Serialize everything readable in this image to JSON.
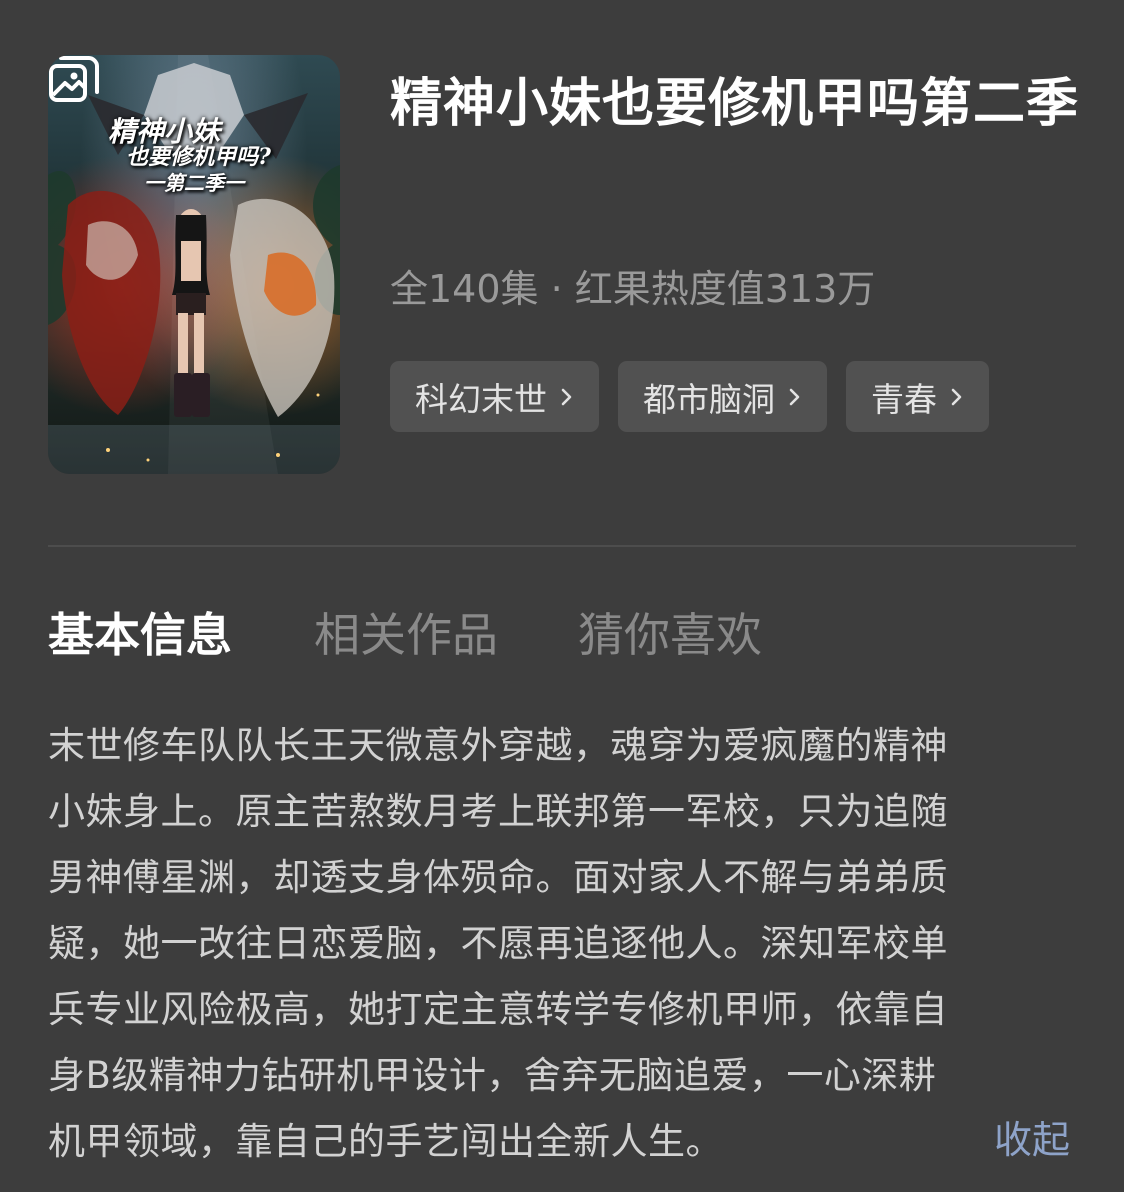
{
  "title": "精神小妹也要修机甲吗第二季",
  "poster": {
    "title_line1": "精神小妹",
    "title_line2": "也要修机甲吗?",
    "title_line3": "一第二季一",
    "icon": "gallery-icon"
  },
  "meta": "全140集 · 红果热度值313万",
  "tags": [
    {
      "label": "科幻末世",
      "icon": "chevron-right-icon"
    },
    {
      "label": "都市脑洞",
      "icon": "chevron-right-icon"
    },
    {
      "label": "青春",
      "icon": "chevron-right-icon"
    }
  ],
  "tabs": [
    {
      "label": "基本信息",
      "active": true
    },
    {
      "label": "相关作品",
      "active": false
    },
    {
      "label": "猜你喜欢",
      "active": false
    }
  ],
  "description_lines": [
    "末世修车队队长王天微意外穿越，魂穿为爱疯魔的精神",
    "小妹身上。原主苦熬数月考上联邦第一军校，只为追随",
    "男神傅星渊，却透支身体殒命。面对家人不解与弟弟质",
    "疑，她一改往日恋爱脑，不愿再追逐他人。深知军校单",
    "兵专业风险极高，她打定主意转学专修机甲师，依靠自",
    "身B级精神力钻研机甲设计，舍弃无脑追爱，一心深耕",
    "机甲领域，靠自己的手艺闯出全新人生。"
  ],
  "collapse_label": "收起",
  "colors": {
    "background": "#3d3d3d",
    "tag_background": "#515151",
    "meta_text": "#9a9a9a",
    "link": "#8ea3c9"
  }
}
